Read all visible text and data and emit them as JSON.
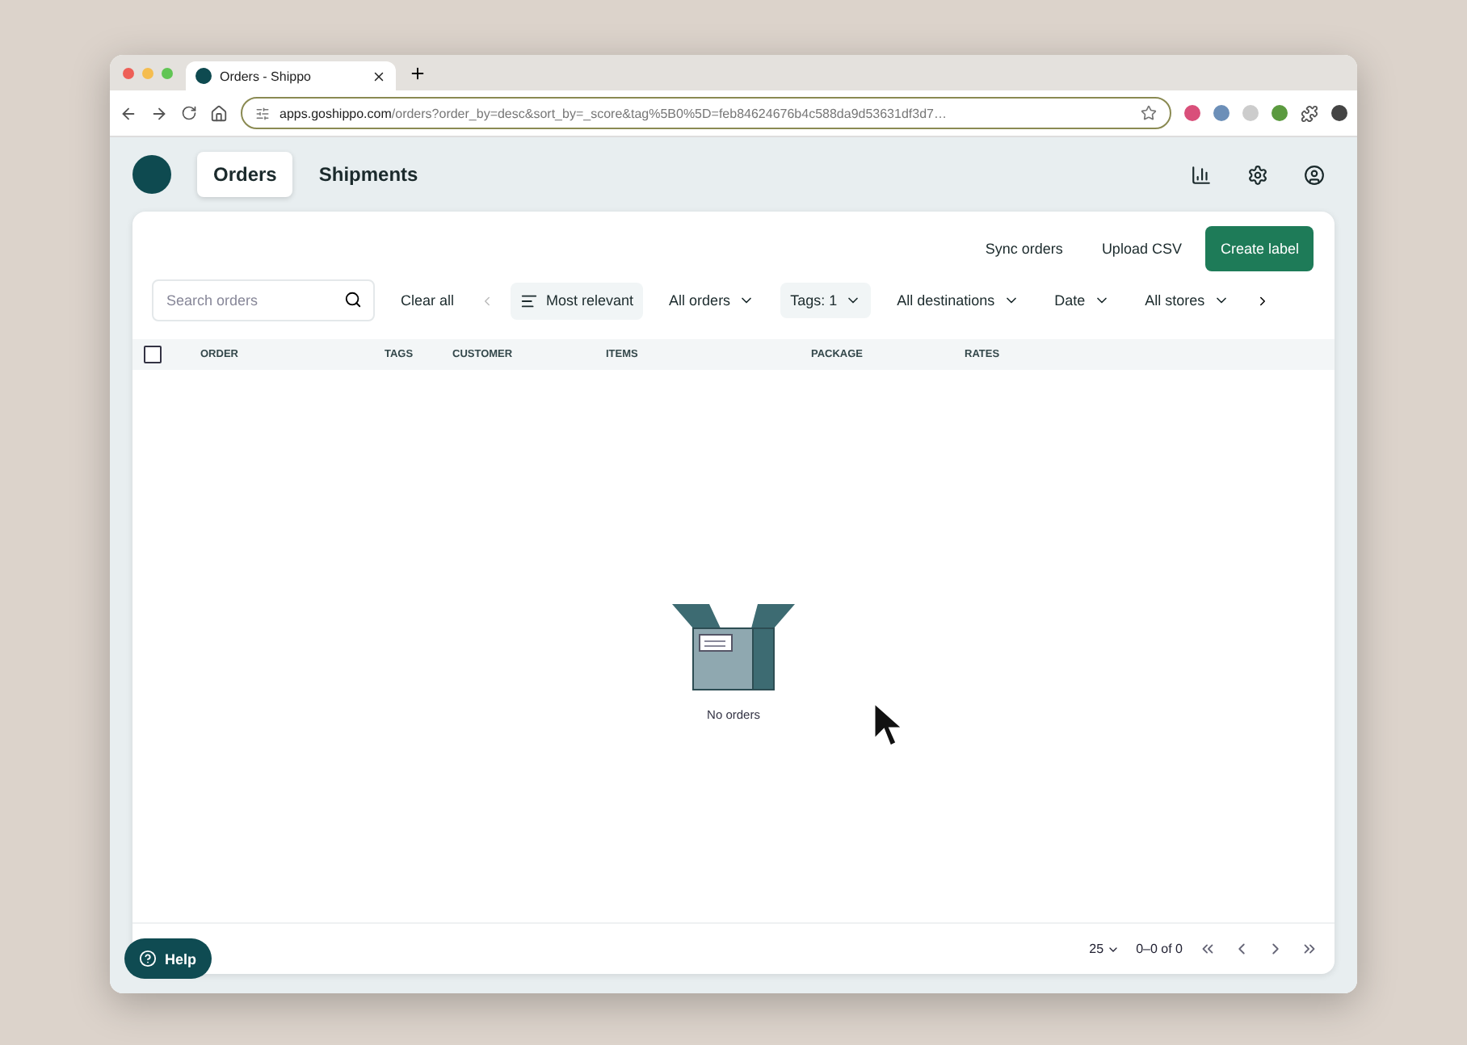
{
  "browser": {
    "tab_title": "Orders - Shippo",
    "url_host": "apps.goshippo.com",
    "url_path": "/orders?order_by=desc&sort_by=_score&tag%5B0%5D=feb84624676b4c588da9d53631df3d7…"
  },
  "nav_tabs": [
    {
      "label": "Orders",
      "selected": true
    },
    {
      "label": "Shipments",
      "selected": false
    }
  ],
  "actions": [
    {
      "label": "Sync orders",
      "kind": "text"
    },
    {
      "label": "Upload CSV",
      "kind": "text"
    },
    {
      "label": "Create label",
      "kind": "primary"
    }
  ],
  "search": {
    "placeholder": "Search orders"
  },
  "clear_all": "Clear all",
  "filters": [
    {
      "label": "Most relevant",
      "kind": "sort"
    },
    {
      "label": "All orders",
      "kind": "dropdown"
    },
    {
      "label": "Tags: 1",
      "kind": "active"
    },
    {
      "label": "All destinations",
      "kind": "dropdown"
    },
    {
      "label": "Date",
      "kind": "dropdown"
    },
    {
      "label": "All stores",
      "kind": "dropdown"
    }
  ],
  "table": {
    "select_all_checked": false,
    "columns": [
      "ORDER",
      "TAGS",
      "CUSTOMER",
      "ITEMS",
      "PACKAGE",
      "RATES"
    ]
  },
  "empty_state": "No orders",
  "pagination": {
    "page_size": "25",
    "range": "0–0 of 0"
  },
  "help": "Help"
}
